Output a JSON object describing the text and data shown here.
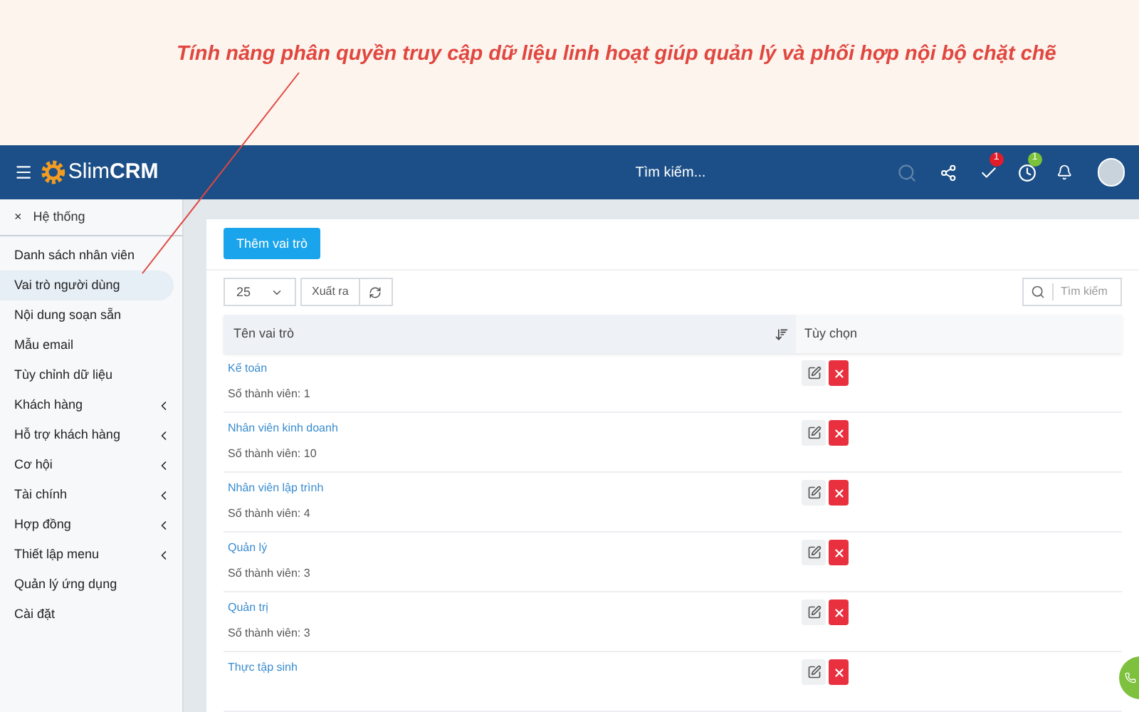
{
  "banner": {
    "caption": "Tính năng phân quyền truy cập dữ liệu linh hoạt giúp quản lý và phối hợp nội bộ chặt chẽ"
  },
  "header": {
    "logo_light": "Slim",
    "logo_bold": "CRM",
    "search": {
      "placeholder": "Tìm kiếm..."
    },
    "tasks_badge": "1",
    "clock_badge": "1"
  },
  "sidebar": {
    "section": {
      "close": "×",
      "title": "Hệ thống"
    },
    "items": [
      {
        "label": "Danh sách nhân viên",
        "selected": false,
        "expandable": false
      },
      {
        "label": "Vai trò người dùng",
        "selected": true,
        "expandable": false
      },
      {
        "label": "Nội dung soạn sẵn",
        "selected": false,
        "expandable": false
      },
      {
        "label": "Mẫu email",
        "selected": false,
        "expandable": false
      },
      {
        "label": "Tùy chỉnh dữ liệu",
        "selected": false,
        "expandable": false
      },
      {
        "label": "Khách hàng",
        "selected": false,
        "expandable": true
      },
      {
        "label": "Hỗ trợ khách hàng",
        "selected": false,
        "expandable": true
      },
      {
        "label": "Cơ hội",
        "selected": false,
        "expandable": true
      },
      {
        "label": "Tài chính",
        "selected": false,
        "expandable": true
      },
      {
        "label": "Hợp đồng",
        "selected": false,
        "expandable": true
      },
      {
        "label": "Thiết lập menu",
        "selected": false,
        "expandable": true
      },
      {
        "label": "Quản lý ứng dụng",
        "selected": false,
        "expandable": false
      },
      {
        "label": "Cài đặt",
        "selected": false,
        "expandable": false
      }
    ]
  },
  "toolbar": {
    "add_button": "Thêm vai trò",
    "page_size": "25",
    "export_button": "Xuất ra",
    "search": {
      "placeholder": "Tìm kiếm"
    }
  },
  "table": {
    "columns": [
      "Tên vai trò",
      "Tùy chọn"
    ],
    "rows": [
      {
        "name": "Kế toán",
        "members": "Số thành viên: 1"
      },
      {
        "name": "Nhân viên kinh doanh",
        "members": "Số thành viên: 10"
      },
      {
        "name": "Nhân viên lập trình",
        "members": "Số thành viên: 4"
      },
      {
        "name": "Quản lý",
        "members": "Số thành viên: 3"
      },
      {
        "name": "Quản trị",
        "members": "Số thành viên: 3"
      },
      {
        "name": "Thực tập sinh"
      }
    ]
  }
}
